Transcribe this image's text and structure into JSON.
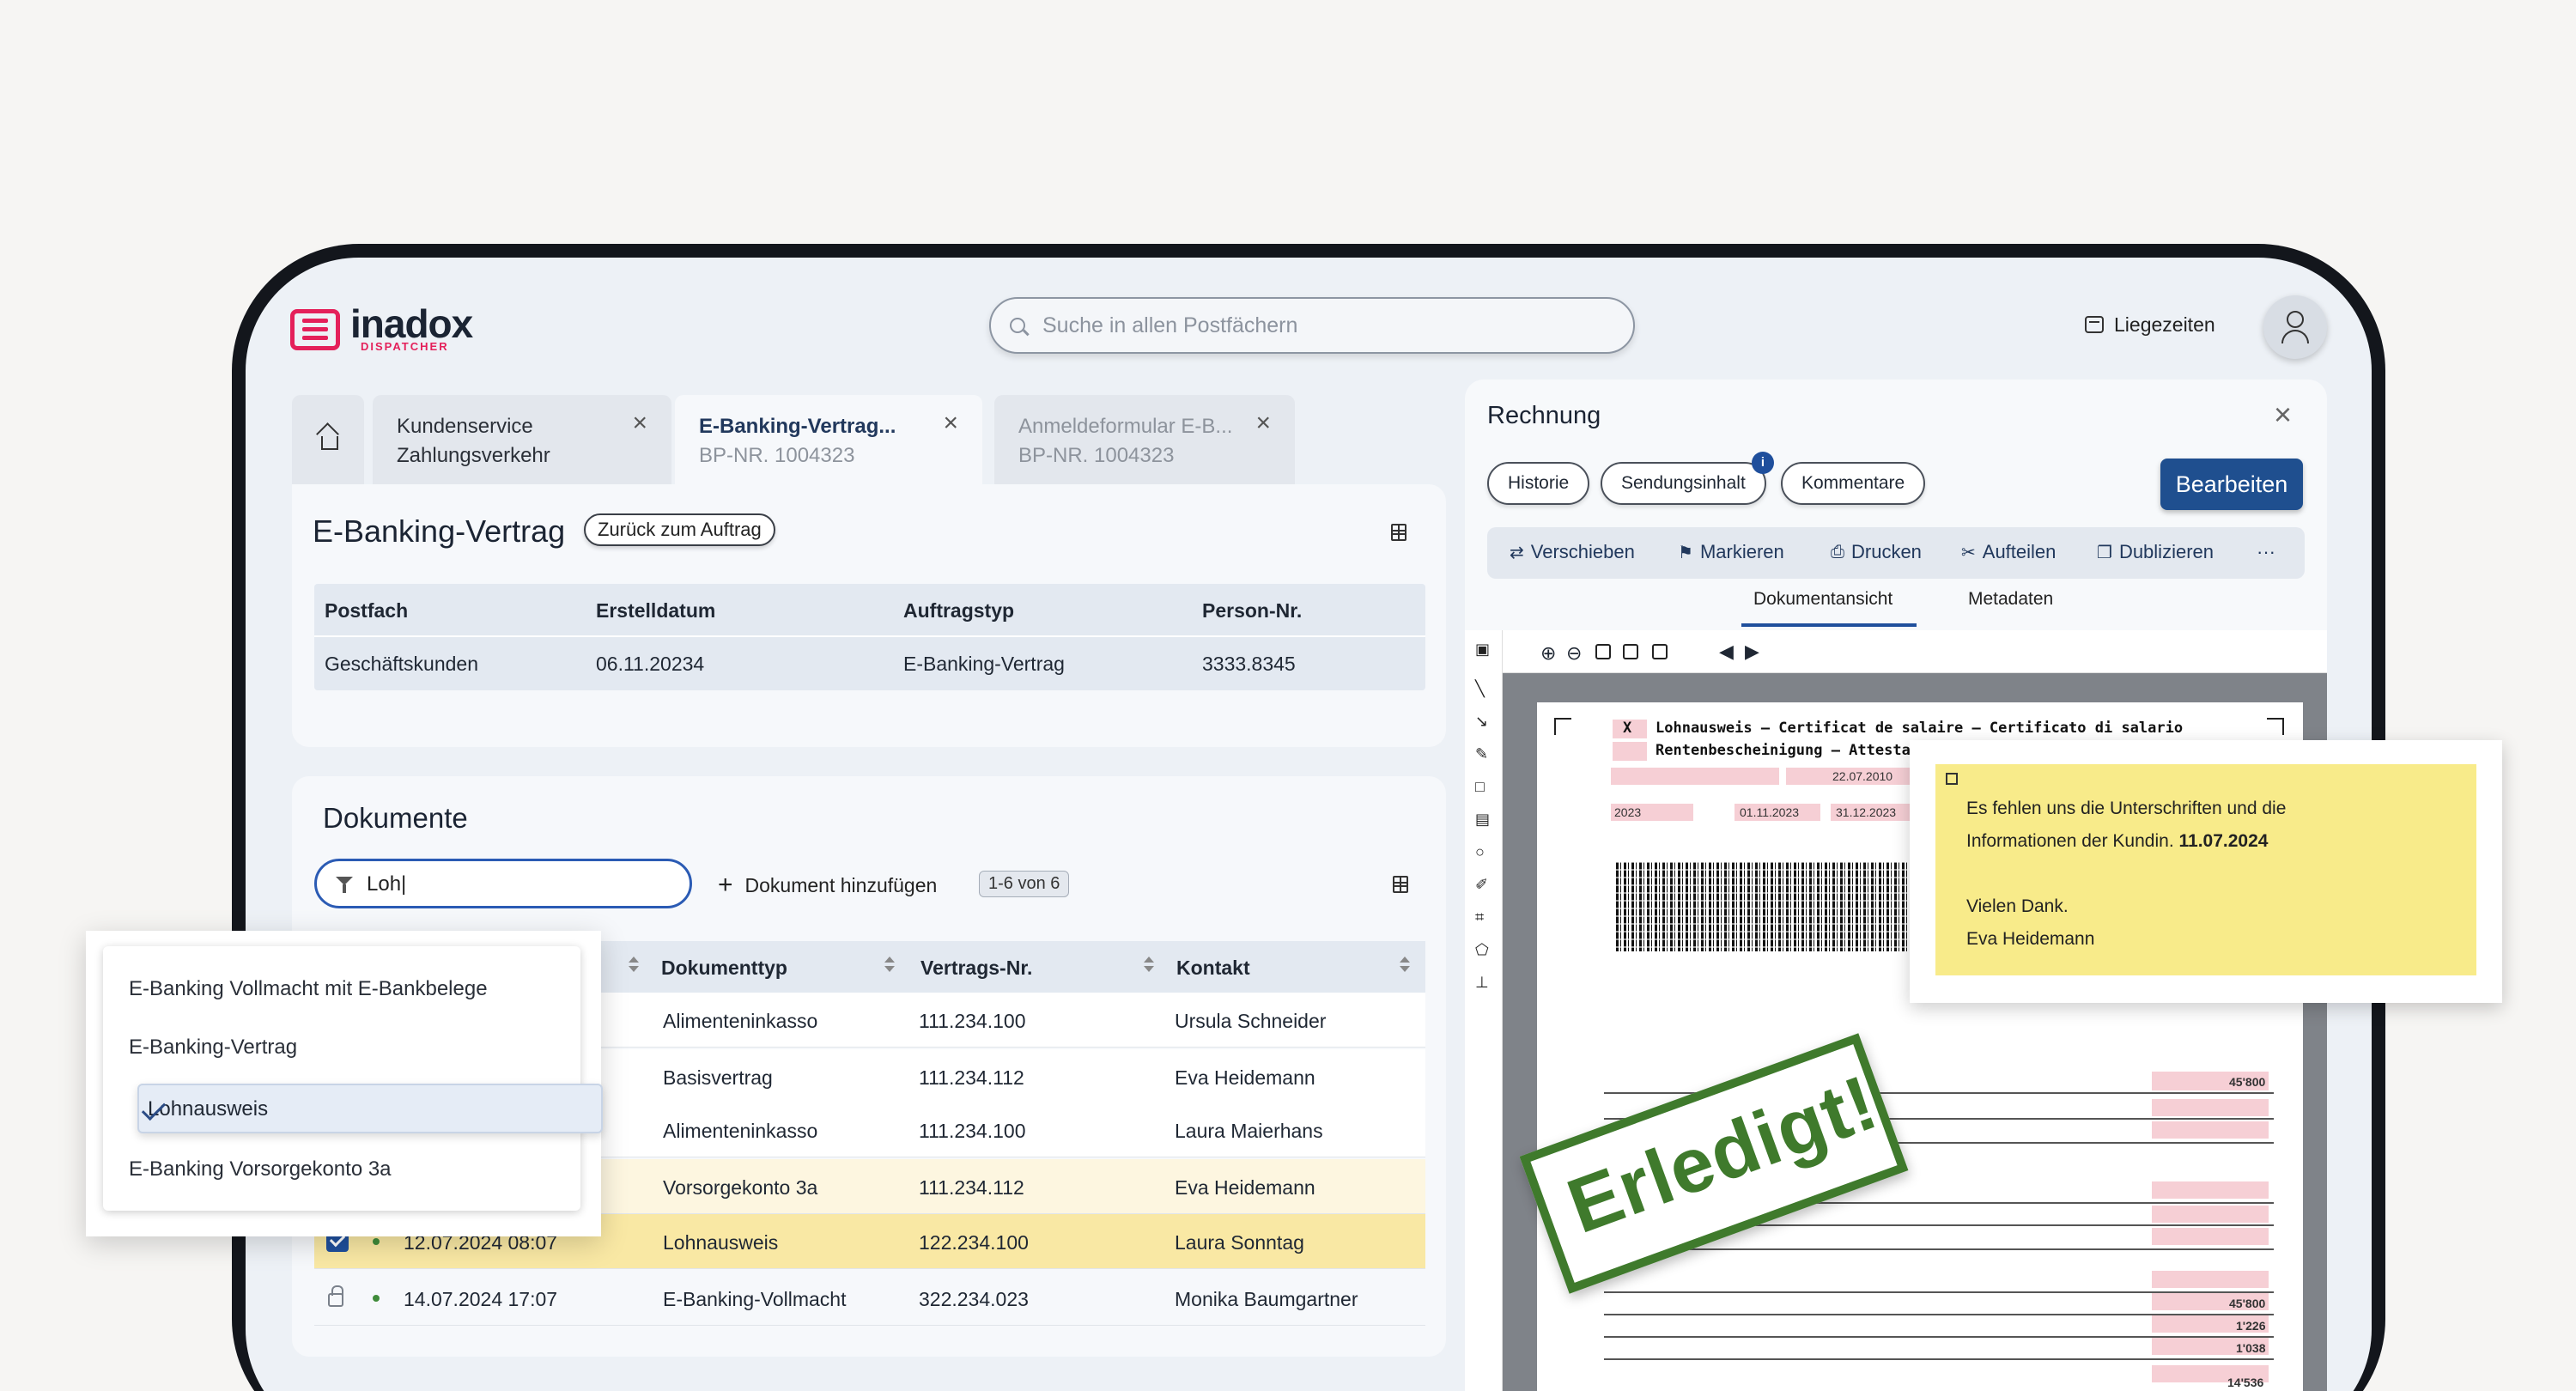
{
  "app": {
    "logo": "inadox",
    "logo_sub": "DISPATCHER"
  },
  "search": {
    "placeholder": "Suche in allen Postfächern"
  },
  "header": {
    "liegezeiten": "Liegezeiten"
  },
  "tabs": [
    {
      "title": "Kundenservice",
      "sub": "Zahlungsverkehr"
    },
    {
      "title": "E-Banking-Vertrag...",
      "sub": "BP-NR. 1004323"
    },
    {
      "title": "Anmeldeformular E-B...",
      "sub": "BP-NR. 1004323"
    }
  ],
  "contract": {
    "title": "E-Banking-Vertrag",
    "back": "Zurück zum Auftrag",
    "headers": [
      "Postfach",
      "Erstelldatum",
      "Auftragstyp",
      "Person-Nr."
    ],
    "row": [
      "Geschäftskunden",
      "06.11.20234",
      "E-Banking-Vertrag",
      "3333.8345"
    ]
  },
  "documents": {
    "title": "Dokumente",
    "filter_value": "Loh|",
    "add": "Dokument hinzufügen",
    "count": "1-6 von 6",
    "headers": [
      "Dokumenttyp",
      "Vertrags-Nr.",
      "Kontakt"
    ],
    "rows": [
      {
        "date": "",
        "type": "Alimenteninkasso",
        "nr": "111.234.100",
        "contact": "Ursula Schneider"
      },
      {
        "date": "",
        "type": "Basisvertrag",
        "nr": "111.234.112",
        "contact": "Eva Heidemann"
      },
      {
        "date": "",
        "type": "Alimenteninkasso",
        "nr": "111.234.100",
        "contact": "Laura Maierhans"
      },
      {
        "date": "",
        "type": "Vorsorgekonto 3a",
        "nr": "111.234.112",
        "contact": "Eva Heidemann"
      },
      {
        "date": "12.07.2024 08:07",
        "type": "Lohnausweis",
        "nr": "122.234.100",
        "contact": "Laura Sonntag"
      },
      {
        "date": "14.07.2024 17:07",
        "type": "E-Banking-Vollmacht",
        "nr": "322.234.023",
        "contact": "Monika Baumgartner"
      }
    ]
  },
  "dropdown": {
    "options": [
      "E-Banking Vollmacht mit E-Bankbelege",
      "E-Banking-Vertrag",
      "Lohnausweis",
      "E-Banking Vorsorgekonto 3a"
    ],
    "selected": "Lohnausweis"
  },
  "invoice": {
    "title": "Rechnung",
    "buttons": [
      "Historie",
      "Sendungsinhalt",
      "Kommentare"
    ],
    "badge": "i",
    "edit": "Bearbeiten",
    "toolbar": [
      "Verschieben",
      "Markieren",
      "Drucken",
      "Aufteilen",
      "Dublizieren",
      "···"
    ],
    "view_tabs": [
      "Dokumentansicht",
      "Metadaten"
    ]
  },
  "document_view": {
    "title_line1": "Lohnausweis – Certificat de salaire – Certificato di salario",
    "title_line2": "Rentenbescheinigung – Attesta",
    "date_birth": "22.07.2010",
    "year": "2023",
    "from": "01.11.2023",
    "to": "31.12.2023",
    "mark_x": "X",
    "amounts": [
      "45'800",
      "45'800",
      "1'226",
      "1'038",
      "14'536"
    ]
  },
  "note": {
    "line1": "Es fehlen uns die Unterschriften und die",
    "line2": "Informationen der Kundin.",
    "date": "11.07.2024",
    "line3": "Vielen Dank.",
    "line4": "Eva Heidemann"
  },
  "stamp": "Erledigt!",
  "colors": {
    "brand": "#e4205a",
    "primary": "#1f4f8f",
    "note": "#f8eb8a",
    "stamp": "#3f7a2c"
  }
}
